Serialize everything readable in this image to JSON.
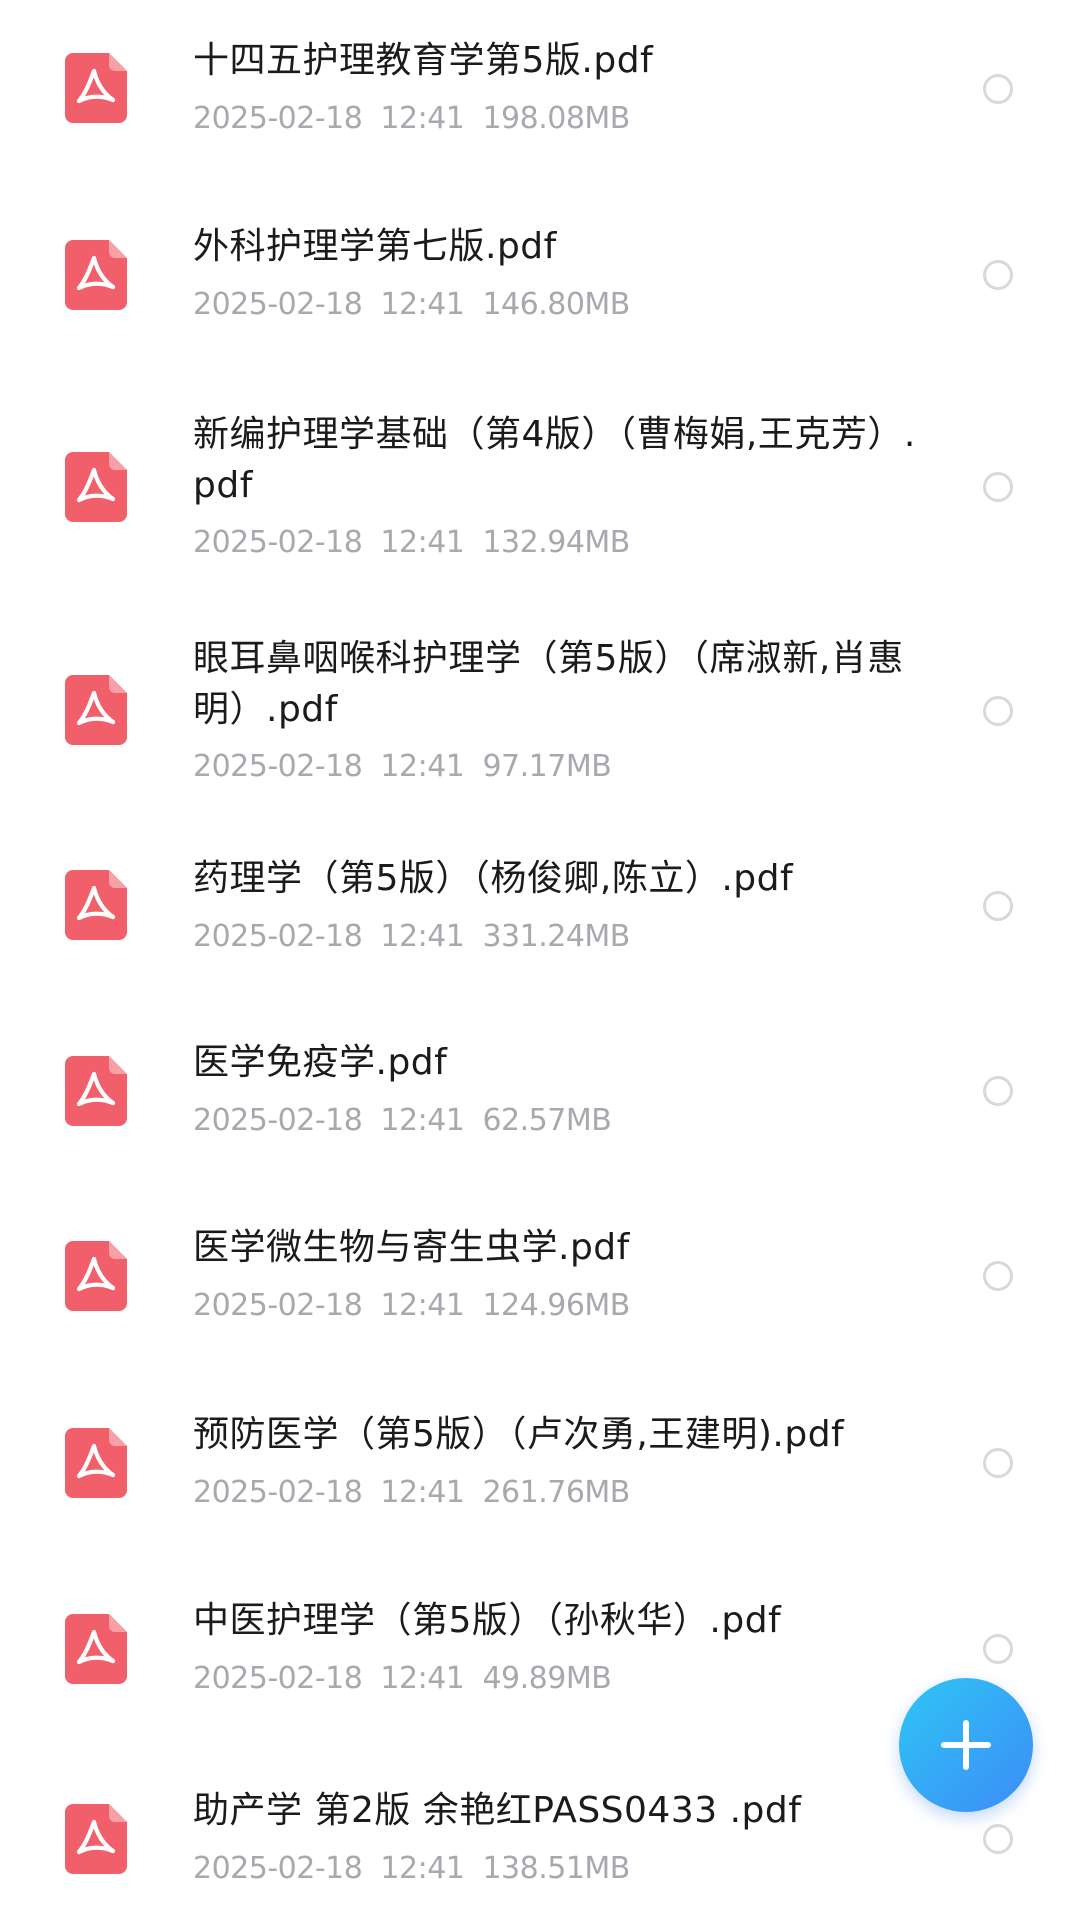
{
  "files": [
    {
      "name": "十四五护理教育学第5版.pdf",
      "meta": "2025-02-18  12:41  198.08MB",
      "icon": "pdf-icon",
      "selected": false
    },
    {
      "name": "外科护理学第七版.pdf",
      "meta": "2025-02-18  12:41  146.80MB",
      "icon": "pdf-icon",
      "selected": false
    },
    {
      "name": "新编护理学基础（第4版）（曹梅娟,王克芳）.pdf",
      "meta": "2025-02-18  12:41  132.94MB",
      "icon": "pdf-icon",
      "selected": false
    },
    {
      "name": "眼耳鼻咽喉科护理学（第5版）（席淑新,肖惠明）.pdf",
      "meta": "2025-02-18  12:41  97.17MB",
      "icon": "pdf-icon",
      "selected": false
    },
    {
      "name": "药理学（第5版）（杨俊卿,陈立）.pdf",
      "meta": "2025-02-18  12:41  331.24MB",
      "icon": "pdf-icon",
      "selected": false
    },
    {
      "name": "医学免疫学.pdf",
      "meta": "2025-02-18  12:41  62.57MB",
      "icon": "pdf-icon",
      "selected": false
    },
    {
      "name": "医学微生物与寄生虫学.pdf",
      "meta": "2025-02-18  12:41  124.96MB",
      "icon": "pdf-icon",
      "selected": false
    },
    {
      "name": "预防医学（第5版）（卢次勇,王建明).pdf",
      "meta": "2025-02-18  12:41  261.76MB",
      "icon": "pdf-icon",
      "selected": false
    },
    {
      "name": "中医护理学（第5版）（孙秋华）.pdf",
      "meta": "2025-02-18  12:41  49.89MB",
      "icon": "pdf-icon",
      "selected": false
    },
    {
      "name": "助产学 第2版 余艳红PASS0433  .pdf",
      "meta": "2025-02-18  12:41  138.51MB",
      "icon": "pdf-icon",
      "selected": false
    }
  ],
  "fab": {
    "icon": "plus-icon"
  },
  "colors": {
    "pdf_icon": "#f1606a",
    "fab_start": "#2ec6f5",
    "fab_end": "#3d8bf7",
    "meta_text": "#a7a9ae",
    "radio_border": "#d9d9dc"
  }
}
